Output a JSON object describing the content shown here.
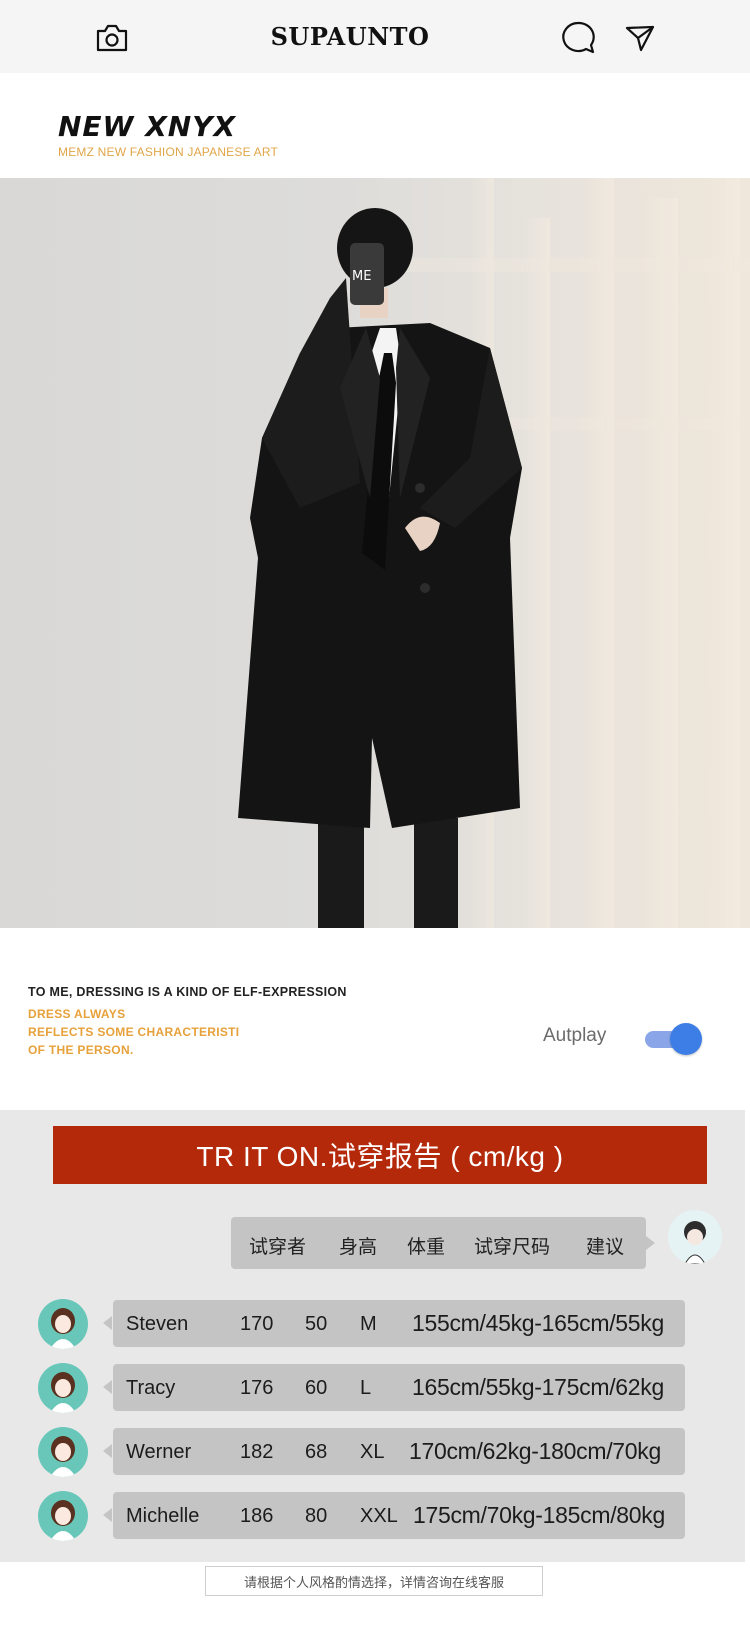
{
  "topbar": {
    "brand": "SUPAUNTO",
    "icons": [
      "camera-icon",
      "chat-icon",
      "send-icon"
    ]
  },
  "logo": {
    "title": "NEW XNYX",
    "subtitle": "MEMZ NEW FASHION JAPANESE ART"
  },
  "hero": {
    "phone_text": "ME"
  },
  "quote": {
    "line1": "TO ME, DRESSING IS A KIND OF   ELF-EXPRESSION",
    "line2": "DRESS ALWAYS",
    "line3": "REFLECTS SOME CHARACTERISTI",
    "line4": "OF THE PERSON."
  },
  "autoplay": {
    "label": "Autplay",
    "enabled": true,
    "accent": "#3d7de6"
  },
  "report": {
    "banner": "TR   IT ON.试穿报告 ( cm/kg )",
    "banner_color": "#b5290b",
    "headers": [
      "试穿者",
      "身高",
      "体重",
      "试穿尺码",
      "建议"
    ],
    "rows": [
      {
        "name": "Steven",
        "height": "170",
        "weight": "50",
        "size": "M",
        "range": "155cm/45kg-165cm/55kg"
      },
      {
        "name": "Tracy",
        "height": "176",
        "weight": "60",
        "size": "L",
        "range": "165cm/55kg-175cm/62kg"
      },
      {
        "name": "Werner",
        "height": "182",
        "weight": "68",
        "size": "XL",
        "range": "170cm/62kg-180cm/70kg"
      },
      {
        "name": "Michelle",
        "height": "186",
        "weight": "80",
        "size": "XXL",
        "range": "175cm/70kg-185cm/80kg"
      }
    ],
    "footnote": "请根据个人风格酌情选择，详情咨询在线客服"
  }
}
